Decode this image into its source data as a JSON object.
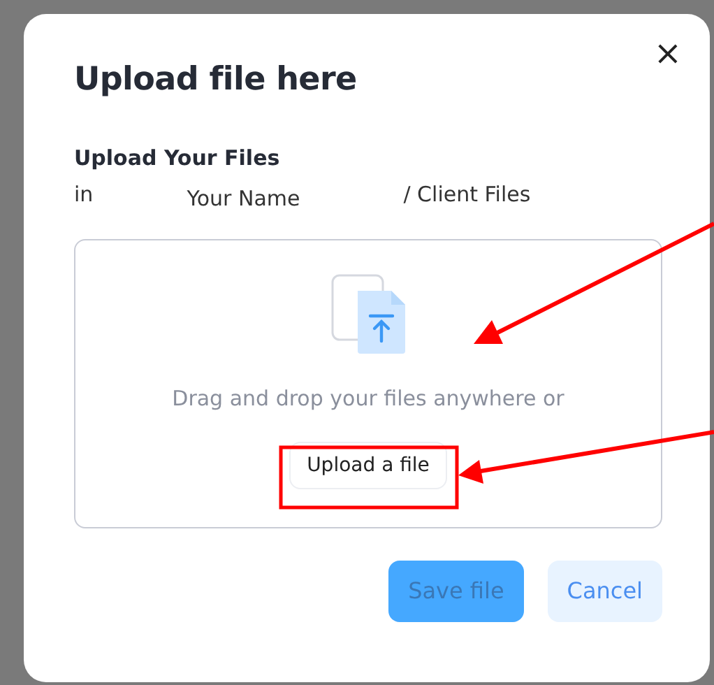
{
  "dialog": {
    "title": "Upload file here",
    "close": "×"
  },
  "section": {
    "heading": "Upload Your Files",
    "prefix": "in",
    "owner": "Your Name",
    "folder": "/ Client Files"
  },
  "dropzone": {
    "hint": "Drag and drop your files anywhere or",
    "button": "Upload a file"
  },
  "buttons": [
    {
      "label": "Save file",
      "kind": "primary",
      "disabled": true
    },
    {
      "label": "Cancel",
      "kind": "secondary",
      "disabled": false
    }
  ]
}
